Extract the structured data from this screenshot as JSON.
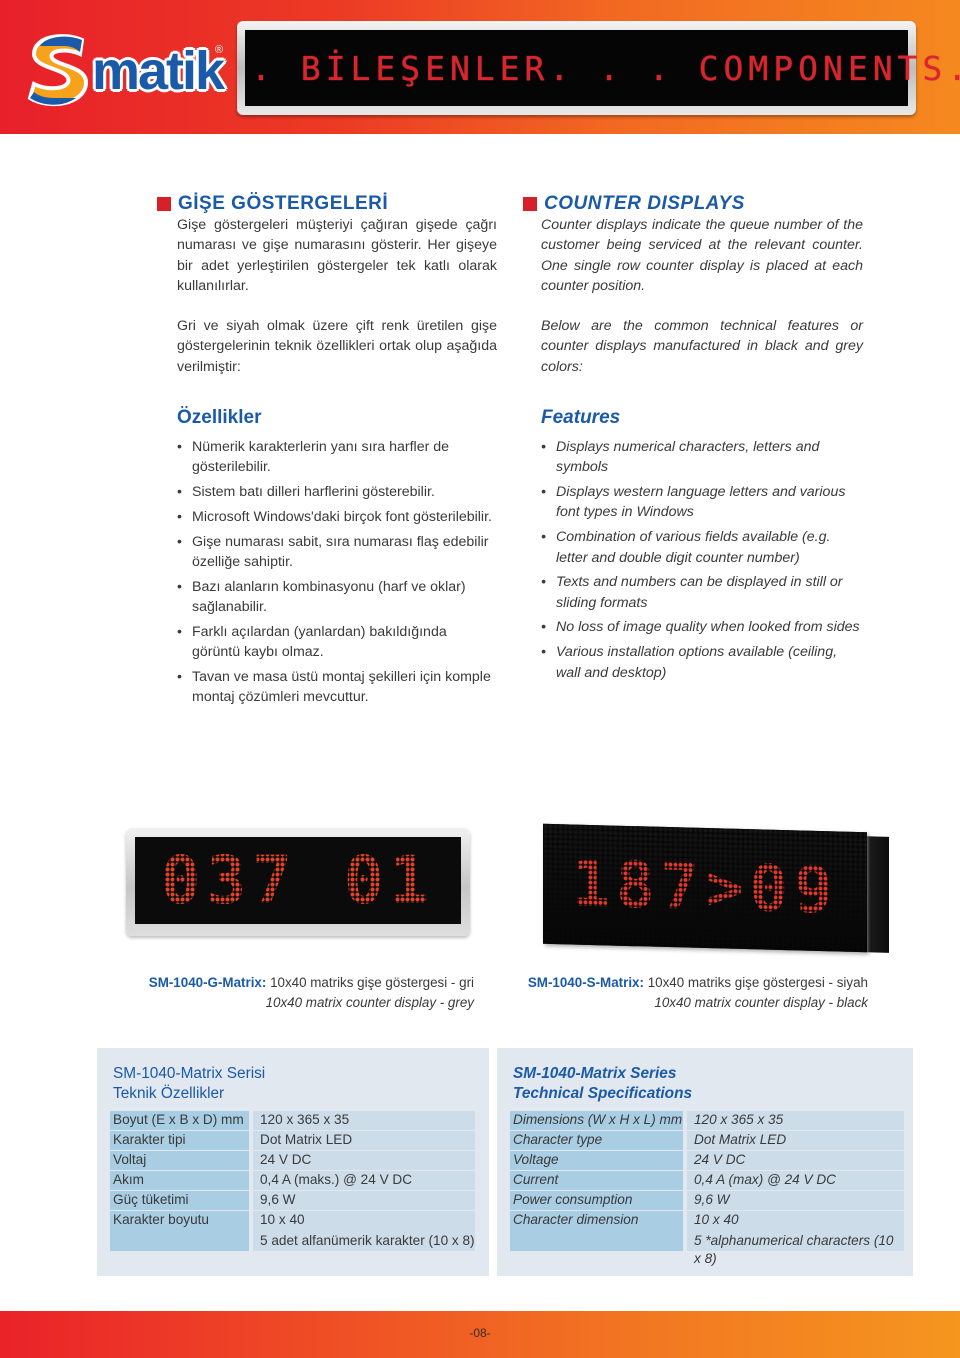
{
  "header": {
    "logo_text": "matik",
    "logo_letter": "S",
    "logo_registered": "®",
    "banner_text": ". BİLEŞENLER. . . COMPONENTS. .",
    "brand_colors": {
      "red": "#e8202a",
      "orange": "#f5891f",
      "blue": "#1a5aa8",
      "led_red": "#d8262e"
    }
  },
  "left": {
    "title": "GİŞE GÖSTERGELERİ",
    "intro": "Gişe göstergeleri müşteriyi çağıran gişede çağrı numarası ve gişe numarasını gösterir. Her gişeye bir adet yerleştirilen göstergeler tek katlı olarak kullanılırlar.",
    "intro2": "Gri ve siyah olmak üzere çift renk üretilen gişe göstergelerinin teknik özellikleri ortak olup aşağıda verilmiştir:",
    "features_title": "Özellikler",
    "features": [
      "Nümerik karakterlerin yanı sıra harfler de gösterilebilir.",
      "Sistem batı dilleri harflerini gösterebilir.",
      "Microsoft Windows'daki birçok font gösterilebilir.",
      "Gişe numarası sabit, sıra numarası flaş edebilir özelliğe sahiptir.",
      "Bazı alanların kombinasyonu (harf ve oklar) sağlanabilir.",
      "Farklı açılardan (yanlardan) bakıldığında görüntü kaybı olmaz.",
      "Tavan ve masa üstü montaj şekilleri için komple montaj çözümleri mevcuttur."
    ]
  },
  "right": {
    "title": "COUNTER DISPLAYS",
    "intro": "Counter displays indicate the queue number of the customer being serviced at the relevant counter. One single row counter display is placed at each counter position.",
    "intro2": "Below are the common technical features or counter displays manufactured in black and grey colors:",
    "features_title": "Features",
    "features": [
      "Displays numerical characters, letters and symbols",
      "Displays western language letters and various font types in Windows",
      "Combination of various fields available (e.g. letter and double digit counter number)",
      "Texts and numbers can be displayed in still or sliding formats",
      "No loss of image quality when looked from sides",
      "Various installation options available (ceiling, wall and desktop)"
    ]
  },
  "products": [
    {
      "display_text": "037 01",
      "model": "SM-1040-G-Matrix:",
      "desc_tr": "10x40 matriks gişe göstergesi - gri",
      "desc_en": "10x40 matrix counter display - grey"
    },
    {
      "display_text": "187>09",
      "model": "SM-1040-S-Matrix:",
      "desc_tr": "10x40 matriks gişe göstergesi - siyah",
      "desc_en": "10x40 matrix counter display - black"
    }
  ],
  "spec_tr": {
    "title1": "SM-1040-Matrix Serisi",
    "title2": "Teknik Özellikler",
    "rows": [
      {
        "key": "Boyut (E x B x D) mm",
        "value": "120 x 365 x 35"
      },
      {
        "key": "Karakter tipi",
        "value": "Dot Matrix LED"
      },
      {
        "key": "Voltaj",
        "value": "24 V DC"
      },
      {
        "key": "Akım",
        "value": "0,4 A (maks.) @ 24 V DC"
      },
      {
        "key": "Güç tüketimi",
        "value": "9,6 W"
      },
      {
        "key": "Karakter boyutu",
        "value": "10 x 40",
        "value2": "5 adet alfanümerik karakter (10 x 8)"
      }
    ]
  },
  "spec_en": {
    "title1": "SM-1040-Matrix Series",
    "title2": "Technical Specifications",
    "rows": [
      {
        "key": "Dimensions (W x H x L) mm",
        "value": "120 x 365 x 35"
      },
      {
        "key": "Character type",
        "value": "Dot Matrix LED"
      },
      {
        "key": "Voltage",
        "value": "24 V DC"
      },
      {
        "key": "Current",
        "value": "0,4 A (max) @ 24 V DC"
      },
      {
        "key": "Power consumption",
        "value": "9,6 W"
      },
      {
        "key": "Character dimension",
        "value": "10 x 40",
        "value2": "5 *alphanumerical characters (10 x 8)"
      }
    ]
  },
  "footer": {
    "page_number": "-08-"
  }
}
